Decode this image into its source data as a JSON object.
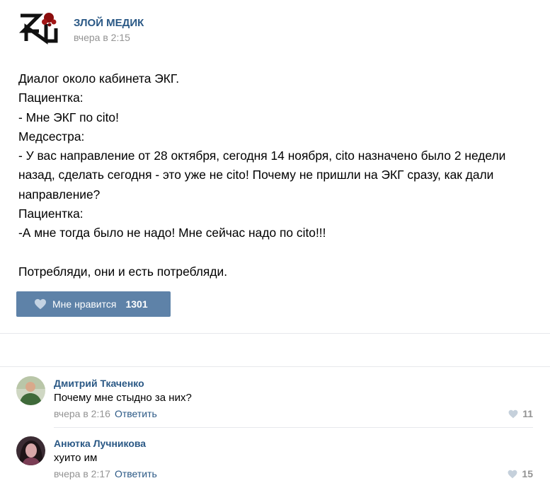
{
  "post": {
    "author": "ЗЛОЙ МЕДИК",
    "time": "вчера в 2:15",
    "lines": [
      "Диалог около кабинета ЭКГ.",
      "Пациентка:",
      "- Мне ЭКГ по cito!",
      "Медсестра:",
      "- У вас направление от 28 октября, сегодня 14 ноября, cito назначено было 2 недели",
      "назад, сделать сегодня - это уже не cito! Почему не пришли на ЭКГ сразу, как дали",
      "направление?",
      "Пациентка:",
      "-А мне тогда было не надо! Мне сейчас надо по cito!!!",
      "",
      "Потребляди, они и есть потребляди."
    ],
    "like_label": "Мне нравится",
    "like_count": "1301"
  },
  "comments": [
    {
      "name": "Дмитрий Ткаченко",
      "text": "Почему мне стыдно за них?",
      "time": "вчера в 2:16",
      "reply": "Ответить",
      "likes": "11"
    },
    {
      "name": "Анютка Лучникова",
      "text": "хуито им",
      "time": "вчера в 2:17",
      "reply": "Ответить",
      "likes": "15"
    }
  ],
  "colors": {
    "link": "#2a5885",
    "like_button": "#5e82a8",
    "muted": "#939393",
    "divider": "#e7e8ec"
  },
  "icons": {
    "logo": "zm-logo-icon",
    "like": "heart-icon"
  }
}
